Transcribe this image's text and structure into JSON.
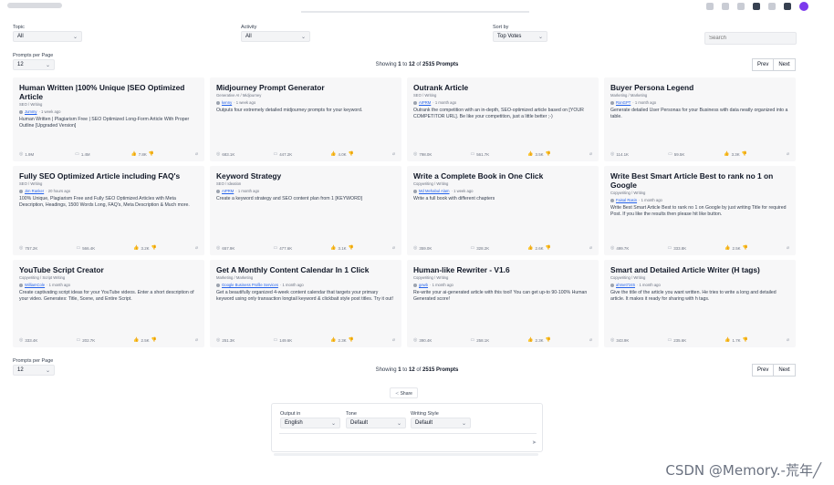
{
  "filters": {
    "topic": {
      "label": "Topic",
      "value": "All"
    },
    "activity": {
      "label": "Activity",
      "value": "All"
    },
    "sort": {
      "label": "Sort by",
      "value": "Top Votes"
    },
    "search_placeholder": "Search"
  },
  "pagination": {
    "per_page_label": "Prompts per Page",
    "per_page_value": "12",
    "showing_prefix": "Showing",
    "from": "1",
    "to_word": "to",
    "to": "12",
    "of_word": "of",
    "total": "2515 Prompts",
    "prev": "Prev",
    "next": "Next"
  },
  "cards": [
    {
      "title": "Human Written |100% Unique |SEO Optimized Article",
      "category": "SEO / Writing",
      "author": "Jummy",
      "time": "· 1 week ago",
      "desc": "Human Written | Plagiarism Free | SEO Optimized Long-Form Article With Proper Outline [Upgraded Version]",
      "views": "1.9M",
      "comments": "1.4M",
      "likes": "7.8K"
    },
    {
      "title": "Midjourney Prompt Generator",
      "category": "Generative AI / Midjourney",
      "author": "kenny",
      "time": "· 1 week ago",
      "desc": "Outputs four extremely detailed midjourney prompts for your keyword.",
      "views": "683.1K",
      "comments": "447.2K",
      "likes": "4.0K"
    },
    {
      "title": "Outrank Article",
      "category": "SEO / Writing",
      "author": "AIPRM",
      "time": "· 1 month ago",
      "desc": "Outrank the competition with an in-depth, SEO-optimized article based on [YOUR COMPETITOR URL]. Be like your competition, just a little better ;-)",
      "views": "798.0K",
      "comments": "561.7K",
      "likes": "3.5K"
    },
    {
      "title": "Buyer Persona Legend",
      "category": "Marketing / Marketing",
      "author": "RonGPT",
      "time": "· 1 month ago",
      "desc": "Generate detailed User Personas for your Business with data neatly organized into a table.",
      "views": "114.1K",
      "comments": "59.5K",
      "likes": "3.3K"
    },
    {
      "title": "Fully SEO Optimized Article including FAQ's",
      "category": "SEO / Writing",
      "author": "Jim Ranker",
      "time": "· 20 hours ago",
      "desc": "100% Unique, Plagiarism Free and Fully SEO Optimized Articles with Meta Description, Headings, 1500 Words Long, FAQ's, Meta Description & Much more.",
      "views": "757.2K",
      "comments": "566.4K",
      "likes": "3.2K"
    },
    {
      "title": "Keyword Strategy",
      "category": "SEO / Ideation",
      "author": "AIPRM",
      "time": "· 1 month ago",
      "desc": "Create a keyword strategy and SEO content plan from 1 [KEYWORD]",
      "views": "657.9K",
      "comments": "477.6K",
      "likes": "3.1K"
    },
    {
      "title": "Write a Complete Book in One Click",
      "category": "Copywriting / Writing",
      "author": "Md Mehabul Alam",
      "time": "· 1 week ago",
      "desc": "Write a full book with different chapters",
      "views": "359.0K",
      "comments": "328.2K",
      "likes": "2.6K"
    },
    {
      "title": "Write Best Smart Article Best to rank no 1 on Google",
      "category": "Copywriting / Writing",
      "author": "Faisal Rasin",
      "time": "· 1 month ago",
      "desc": "Write Best Smart Article Best to rank no 1 on Google by just writing Title for required Post. If you like the results then please hit like button.",
      "views": "499.7K",
      "comments": "333.8K",
      "likes": "2.5K"
    },
    {
      "title": "YouTube Script Creator",
      "category": "Copywriting / Script Writing",
      "author": "WilliamCole",
      "time": "· 1 month ago",
      "desc": "Create captivating script ideas for your YouTube videos. Enter a short description of your video. Generates: Title, Scene, and Entire Script.",
      "views": "333.4K",
      "comments": "202.7K",
      "likes": "2.5K"
    },
    {
      "title": "Get A Monthly Content Calendar In 1 Click",
      "category": "Marketing / Marketing",
      "author": "Google Business Profile Services",
      "time": "· 1 month ago",
      "desc": "Get a beautifully organized 4-week content calendar that targets your primary keyword using only transaction longtail keyword & clickbait style post titles. Try it out!",
      "views": "251.3K",
      "comments": "149.6K",
      "likes": "2.3K"
    },
    {
      "title": "Human-like Rewriter - V1.6",
      "category": "Copywriting / Writing",
      "author": "gewb",
      "time": "· 1 month ago",
      "desc": "Re-write your ai-generated article with this tool! You can get up-to 90-100% Human Generated score!",
      "views": "390.4K",
      "comments": "258.1K",
      "likes": "2.3K"
    },
    {
      "title": "Smart and Detailed Article Writer (H tags)",
      "category": "Copywriting / Writing",
      "author": "ahmet7245",
      "time": "· 1 month ago",
      "desc": "Give the title of the article you want written. He tries to write a long and detailed article. It makes it ready for sharing with h tags.",
      "views": "343.9K",
      "comments": "235.6K",
      "likes": "1.7K"
    }
  ],
  "share_label": "Share",
  "composer": {
    "output_label": "Output in",
    "output_value": "English",
    "tone_label": "Tone",
    "tone_value": "Default",
    "style_label": "Writing Style",
    "style_value": "Default"
  },
  "watermark": "CSDN @Memory.-荒年╱",
  "icons": {
    "views": "eye-icon",
    "comments": "comment-icon",
    "likes": "thumbs-up-icon",
    "dislike": "thumbs-down-icon",
    "favorite": "link-icon"
  }
}
